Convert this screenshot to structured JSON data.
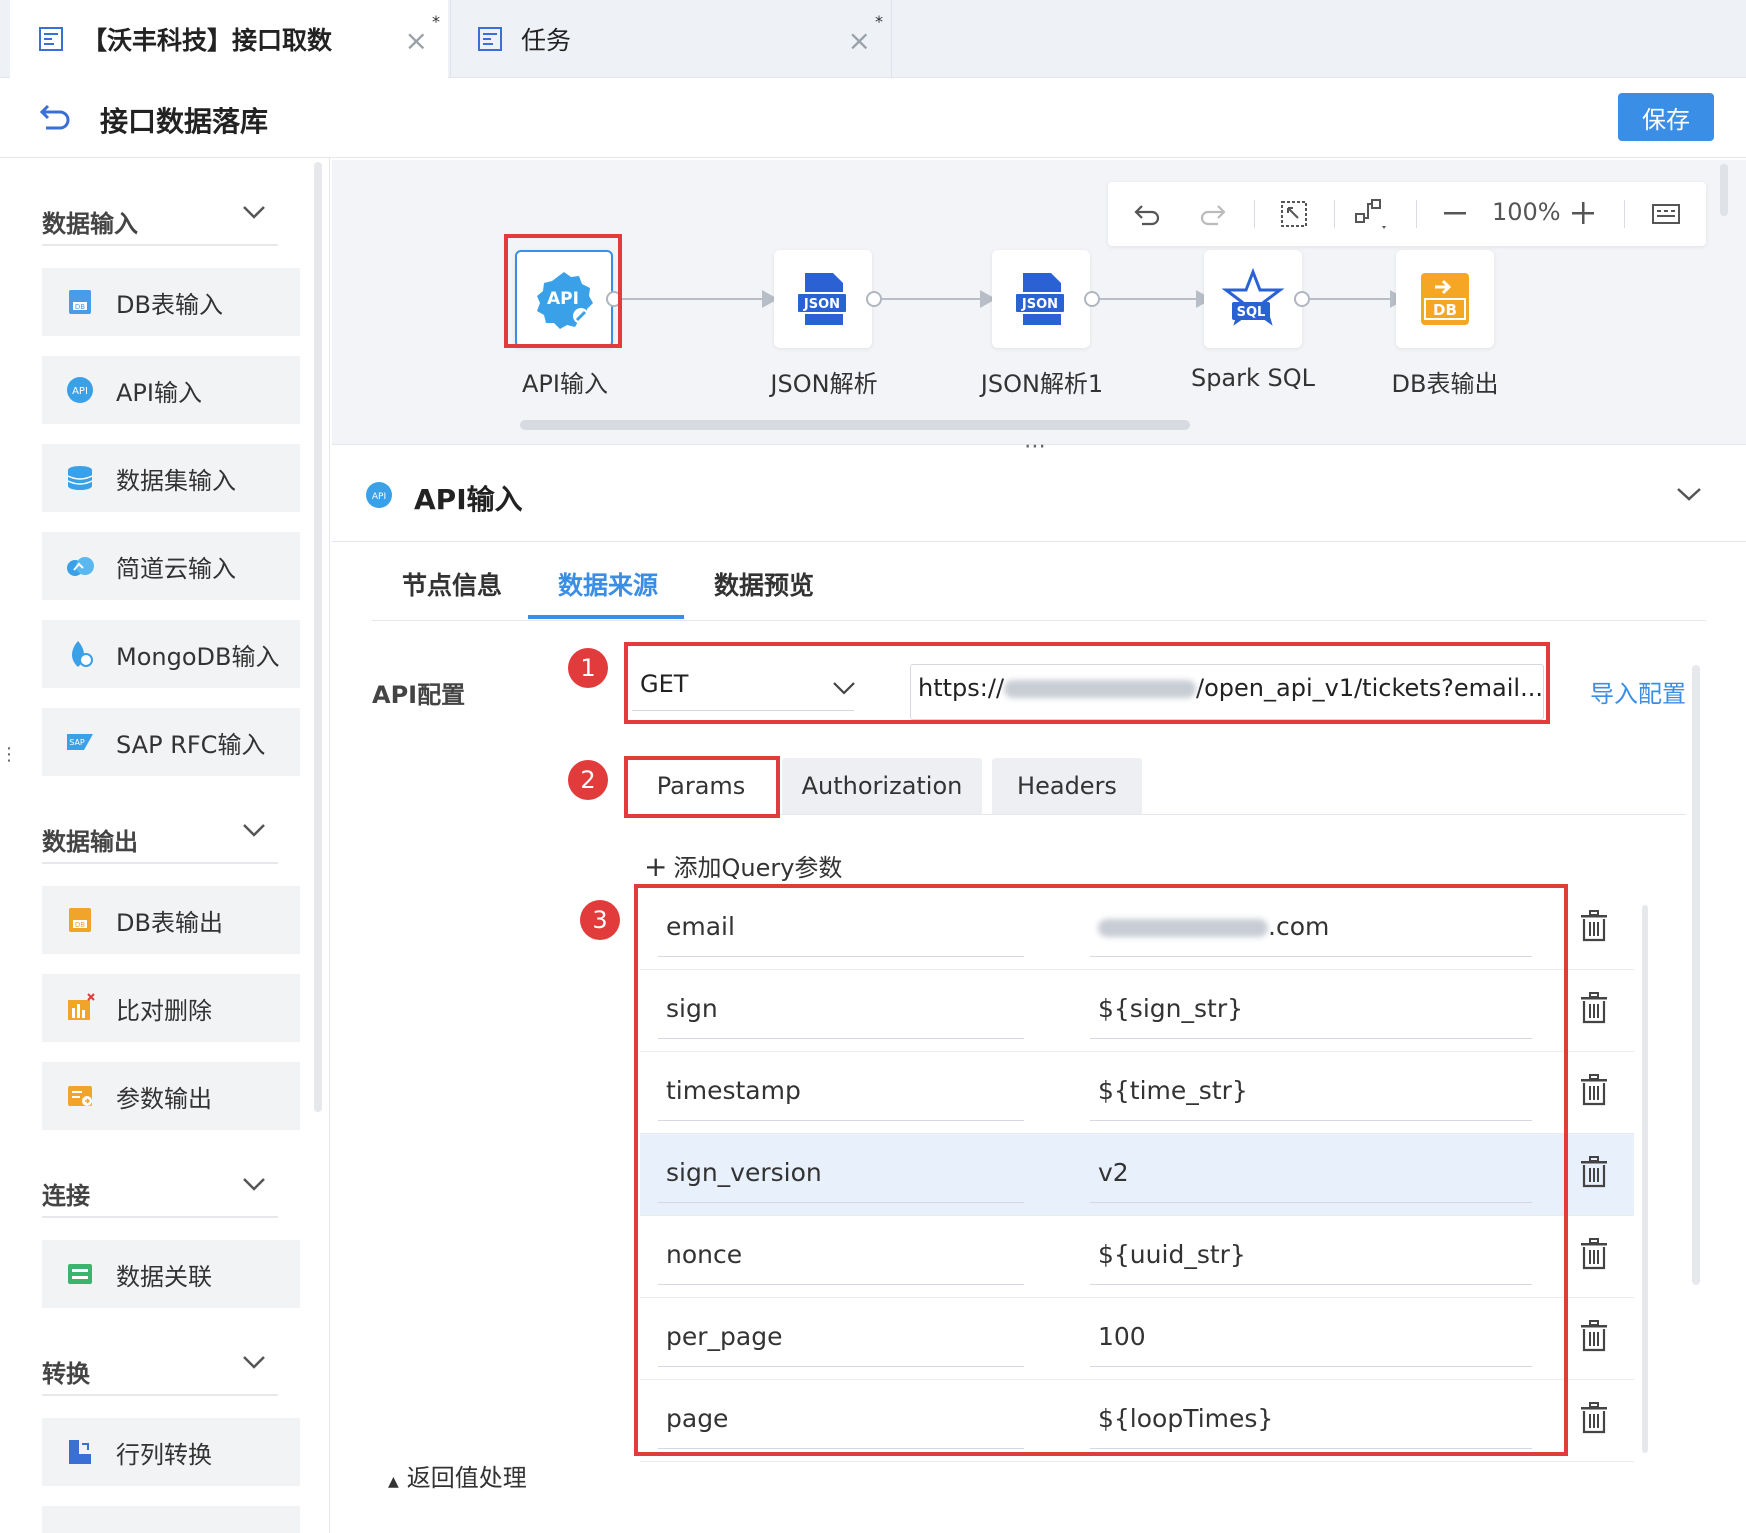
{
  "tabs": [
    {
      "title": "【沃丰科技】接口取数",
      "dirty": "*"
    },
    {
      "title": "任务",
      "dirty": "*"
    }
  ],
  "header": {
    "title": "接口数据落库",
    "save_label": "保存"
  },
  "sidebar": {
    "sections": [
      {
        "title": "数据输入",
        "items": [
          "DB表输入",
          "API输入",
          "数据集输入",
          "简道云输入",
          "MongoDB输入",
          "SAP RFC输入"
        ]
      },
      {
        "title": "数据输出",
        "items": [
          "DB表输出",
          "比对删除",
          "参数输出"
        ]
      },
      {
        "title": "连接",
        "items": [
          "数据关联"
        ]
      },
      {
        "title": "转换",
        "items": [
          "行列转换"
        ]
      }
    ]
  },
  "toolbar": {
    "zoom": "100%"
  },
  "flow": {
    "nodes": [
      {
        "label": "API输入",
        "icon": "api-icon",
        "badge": "API"
      },
      {
        "label": "JSON解析",
        "icon": "json-icon",
        "badge": "JSON"
      },
      {
        "label": "JSON解析1",
        "icon": "json-icon",
        "badge": "JSON"
      },
      {
        "label": "Spark SQL",
        "icon": "spark-sql-icon",
        "badge": "SQL"
      },
      {
        "label": "DB表输出",
        "icon": "db-output-icon",
        "badge": "DB"
      }
    ]
  },
  "config": {
    "title": "API输入",
    "tabs": [
      "节点信息",
      "数据来源",
      "数据预览"
    ],
    "active_tab": "数据来源",
    "api_label": "API配置",
    "method": "GET",
    "url_prefix": "https://",
    "url_suffix": "/open_api_v1/tickets?email...",
    "import_label": "导入配置",
    "sub_tabs": [
      "Params",
      "Authorization",
      "Headers"
    ],
    "add_param_label": "添加Query参数",
    "params": [
      {
        "key": "email",
        "value": ".com"
      },
      {
        "key": "sign",
        "value": "${sign_str}"
      },
      {
        "key": "timestamp",
        "value": "${time_str}"
      },
      {
        "key": "sign_version",
        "value": "v2"
      },
      {
        "key": "nonce",
        "value": "${uuid_str}"
      },
      {
        "key": "per_page",
        "value": "100"
      },
      {
        "key": "page",
        "value": "${loopTimes}"
      }
    ],
    "return_label": "返回值处理"
  },
  "annotations": [
    "1",
    "2",
    "3"
  ],
  "colors": {
    "accent": "#3a8ee6",
    "highlight": "#e23b3b"
  }
}
